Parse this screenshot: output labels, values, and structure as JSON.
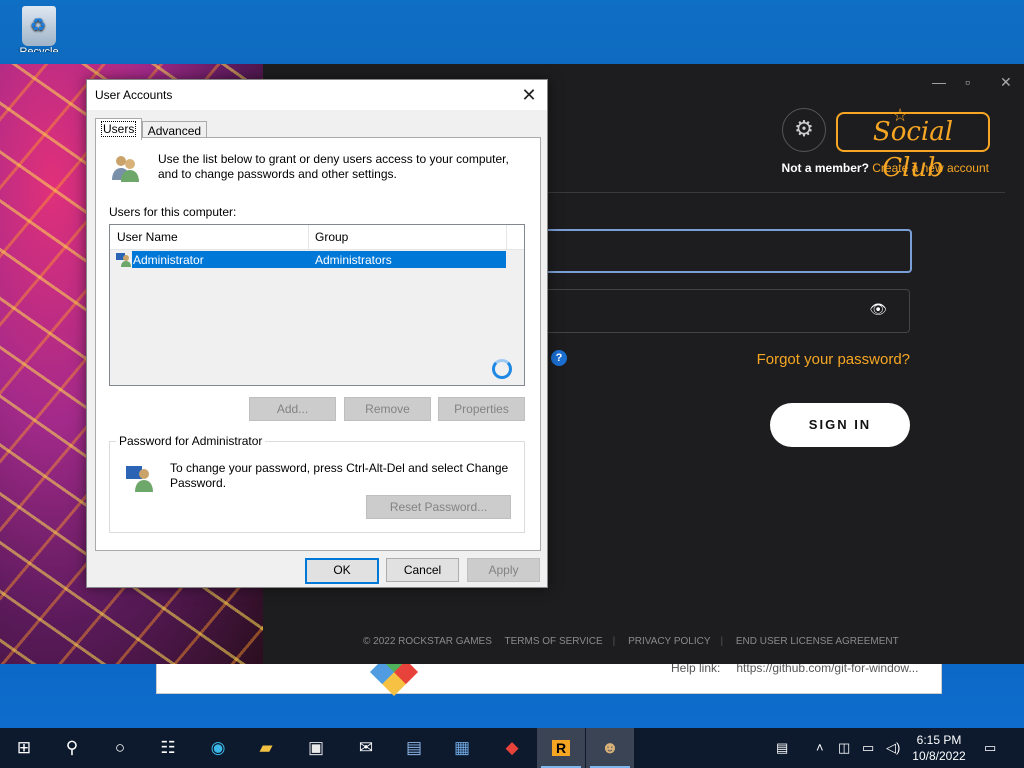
{
  "desktop": {
    "recycle_bin_label": "Recycle Bin"
  },
  "git_installer": {
    "help_label": "Help link:",
    "help_url": "https://github.com/git-for-window..."
  },
  "social_club": {
    "logo_text": "Social Club",
    "not_member": "Not a member?",
    "create_account": "Create a new account",
    "forgot_password": "Forgot your password?",
    "sign_in": "SIGN IN",
    "help_icon": "?",
    "footer": {
      "copyright": "© 2022 ROCKSTAR GAMES",
      "terms": "TERMS OF SERVICE",
      "privacy": "PRIVACY POLICY",
      "eula": "END USER LICENSE AGREEMENT"
    },
    "accent_color": "#f6a623"
  },
  "user_accounts": {
    "title": "User Accounts",
    "tabs": [
      {
        "label": "Users",
        "active": true
      },
      {
        "label": "Advanced",
        "active": false
      }
    ],
    "info_text_1": "Use the list below to grant or deny users access to your computer,",
    "info_text_2": "and to change passwords and other settings.",
    "users_label": "Users for this computer:",
    "columns": [
      "User Name",
      "Group"
    ],
    "rows": [
      {
        "user": "Administrator",
        "group": "Administrators",
        "selected": true
      }
    ],
    "add_button": "Add...",
    "remove_button": "Remove",
    "properties_button": "Properties",
    "password_group_label": "Password for Administrator",
    "password_text_1": "To change your password, press Ctrl-Alt-Del and select Change",
    "password_text_2": "Password.",
    "reset_button": "Reset Password...",
    "ok_button": "OK",
    "cancel_button": "Cancel",
    "apply_button": "Apply",
    "selection_color": "#0078d7"
  },
  "taskbar": {
    "items": [
      "start",
      "search",
      "task-view",
      "widgets",
      "edge",
      "file-explorer",
      "store",
      "mail",
      "user-accounts-cpl",
      "control-panel",
      "git",
      "rockstar",
      "user-accounts-window"
    ],
    "time": "6:15 PM",
    "date": "10/8/2022"
  }
}
